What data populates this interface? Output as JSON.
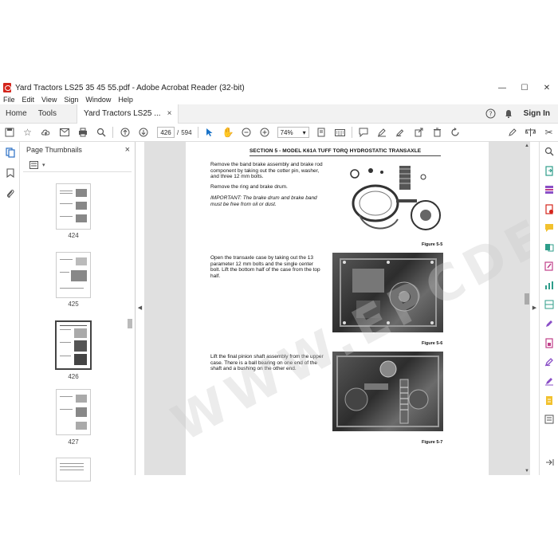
{
  "window": {
    "title": "Yard Tractors LS25 35 45 55.pdf - Adobe Acrobat Reader (32-bit)",
    "minimize": "—",
    "maximize": "☐",
    "close": "✕"
  },
  "menu": [
    "File",
    "Edit",
    "View",
    "Sign",
    "Window",
    "Help"
  ],
  "tabs": {
    "home": "Home",
    "tools": "Tools",
    "document": "Yard Tractors LS25 ...",
    "document_close": "×",
    "sign_in": "Sign In"
  },
  "toolbar": {
    "current_page": "426",
    "separator": "/",
    "total_pages": "594",
    "zoom": "74%"
  },
  "thumbnails": {
    "header": "Page Thumbnails",
    "close": "×",
    "pages": [
      "424",
      "425",
      "426",
      "427"
    ],
    "selected": "426"
  },
  "document": {
    "section_title": "SECTION 5 - MODEL K61A TUFF TORQ HYDROSTATIC TRANSAXLE",
    "blocks": [
      {
        "p1": "Remove the band brake assembly and brake rod component by taking out the cotter pin, washer, and three 12 mm bolts.",
        "p2": "Remove the ring and brake drum.",
        "p3": "IMPORTANT: The brake drum and brake band must be free from oil or dust.",
        "figure": "Figure 5-5"
      },
      {
        "p1": "Open the transaxle case by taking out the 13 parameter 12 mm bolts and the single center bolt. Lift the bottom half of the case from the top half.",
        "figure": "Figure 5-6"
      },
      {
        "p1": "Lift the final pinion shaft assembly from the upper case. There is a ball bearing on one end of the shaft and a bushing on the other end.",
        "figure": "Figure 5-7"
      }
    ],
    "watermark": "WWW.EPCDEPO.COM"
  }
}
